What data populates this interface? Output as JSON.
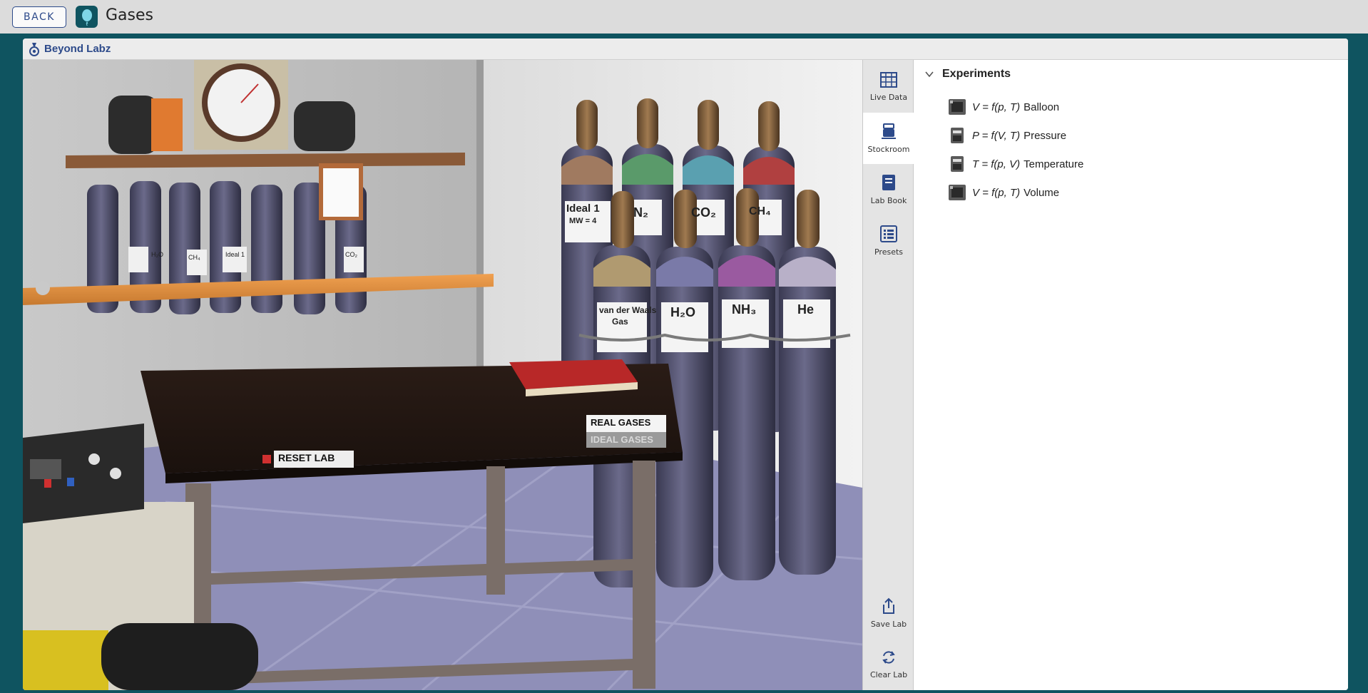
{
  "topbar": {
    "back_label": "BACK",
    "app_title": "Gases",
    "app_icon": "balloon-icon"
  },
  "brand": {
    "name": "Beyond Labz",
    "logo_icon": "beyond-labz-logo-icon"
  },
  "scene": {
    "shelf_cylinders": [
      "H₂O",
      "CH₄",
      "Ideal 1",
      "CO₂"
    ],
    "cylinders_back": [
      {
        "label": "Ideal 1",
        "sub": "MW = 4",
        "cap": "#7a5c3a"
      },
      {
        "label": "N₂",
        "sub": "",
        "cap": "#7a5c3a"
      },
      {
        "label": "CO₂",
        "sub": "",
        "cap": "#7a5c3a"
      },
      {
        "label": "CH₄",
        "sub": "",
        "cap": "#7a5c3a"
      }
    ],
    "cylinders_front": [
      {
        "label": "van der Waals",
        "sub": "Gas"
      },
      {
        "label": "H₂O",
        "sub": ""
      },
      {
        "label": "NH₃",
        "sub": ""
      },
      {
        "label": "He",
        "sub": ""
      }
    ],
    "reset_label": "RESET LAB",
    "real_gases_label": "REAL GASES",
    "ideal_gases_label": "IDEAL GASES"
  },
  "rail": {
    "items": [
      {
        "label": "Live Data",
        "icon": "table-grid-icon"
      },
      {
        "label": "Stockroom",
        "icon": "stockroom-icon"
      },
      {
        "label": "Lab Book",
        "icon": "lab-book-icon"
      },
      {
        "label": "Presets",
        "icon": "presets-list-icon"
      },
      {
        "label": "Save Lab",
        "icon": "share-upload-icon"
      },
      {
        "label": "Clear Lab",
        "icon": "refresh-icon"
      }
    ],
    "active": "Stockroom"
  },
  "panel": {
    "title": "Experiments",
    "toggle_icon": "chevron-down-icon",
    "experiments": [
      {
        "formula": "V = f(p, T)",
        "name": "Balloon",
        "icon": "balloon-apparatus-icon"
      },
      {
        "formula": "P = f(V, T)",
        "name": "Pressure",
        "icon": "pressure-apparatus-icon"
      },
      {
        "formula": "T = f(p, V)",
        "name": "Temperature",
        "icon": "temperature-apparatus-icon"
      },
      {
        "formula": "V = f(p, T)",
        "name": "Volume",
        "icon": "volume-apparatus-icon"
      }
    ]
  },
  "colors": {
    "background": "#0f5460",
    "accent": "#2d4a8a",
    "header": "#dcdcdc"
  }
}
